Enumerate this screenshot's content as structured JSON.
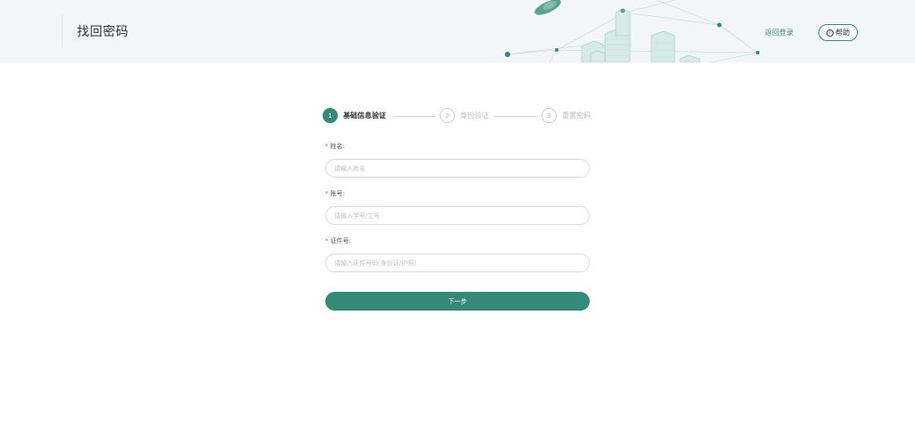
{
  "header": {
    "title": "找回密码",
    "back_login": "返回登录",
    "help": "帮助",
    "help_icon_glyph": "i"
  },
  "steps": [
    {
      "num": "1",
      "label": "基础信息验证",
      "state": "active"
    },
    {
      "num": "2",
      "label": "身份验证",
      "state": "inactive"
    },
    {
      "num": "3",
      "label": "重置密码",
      "state": "inactive"
    }
  ],
  "form": {
    "required_mark": "*",
    "name": {
      "label": "姓名:",
      "placeholder": "请输入姓名",
      "value": ""
    },
    "account": {
      "label": "账号:",
      "placeholder": "请输入学号/工号",
      "value": ""
    },
    "id_number": {
      "label": "证件号:",
      "placeholder": "请输入证件号码(身份证/护照)",
      "value": ""
    }
  },
  "next_button": "下一步",
  "colors": {
    "accent": "#358a77",
    "required": "#e35656",
    "header_bg": "#f2f6f9"
  }
}
